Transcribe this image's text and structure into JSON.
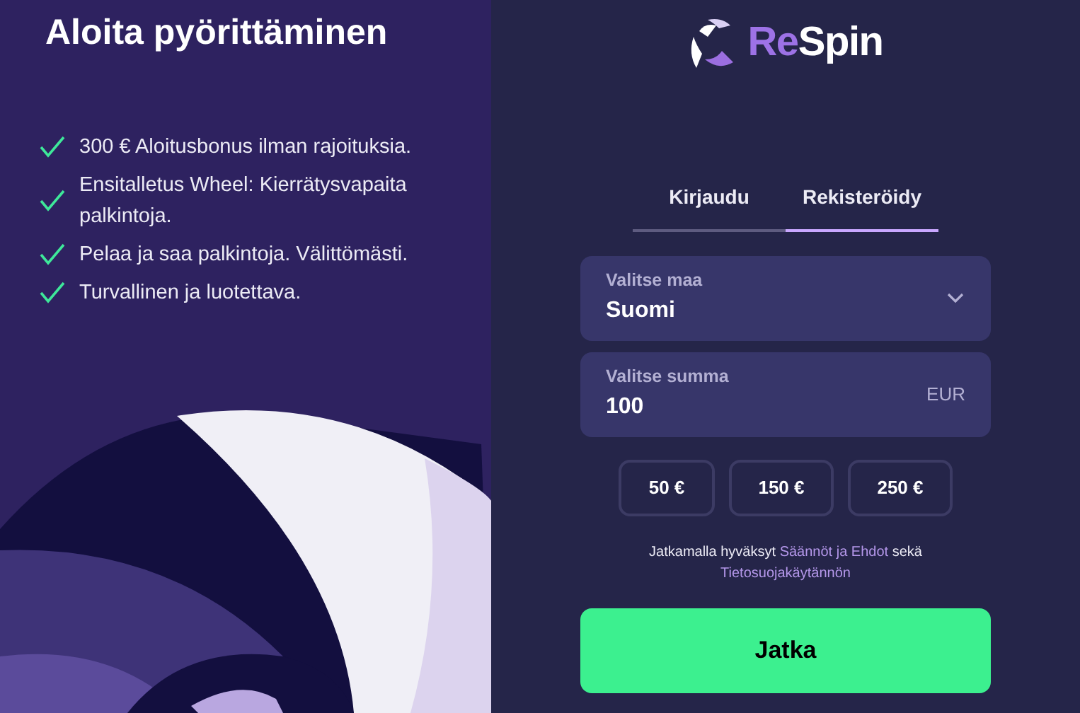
{
  "promo": {
    "title": "Aloita pyörittäminen",
    "benefits": [
      "300 € Aloitusbonus ilman rajoituksia.",
      "Ensitalletus Wheel: Kierrätysvapaita palkintoja.",
      "Pelaa ja saa palkintoja. Välittömästi.",
      "Turvallinen ja luotettava."
    ]
  },
  "logo": {
    "prefix": "Re",
    "suffix": "Spin"
  },
  "tabs": [
    {
      "label": "Kirjaudu",
      "selected": false
    },
    {
      "label": "Rekisteröidy",
      "selected": true
    }
  ],
  "country_select": {
    "label": "Valitse maa",
    "value": "Suomi"
  },
  "amount_field": {
    "label": "Valitse summa",
    "value": "100",
    "currency": "EUR"
  },
  "amount_options": [
    "50 €",
    "150 €",
    "250 €"
  ],
  "terms": {
    "prefix": "Jatkamalla hyväksyt",
    "link_1": "Säännöt ja Ehdot",
    "middle": "sekä",
    "link_2": "Tietosuojakäytännön"
  },
  "continue_button": {
    "label": "Jatka"
  }
}
